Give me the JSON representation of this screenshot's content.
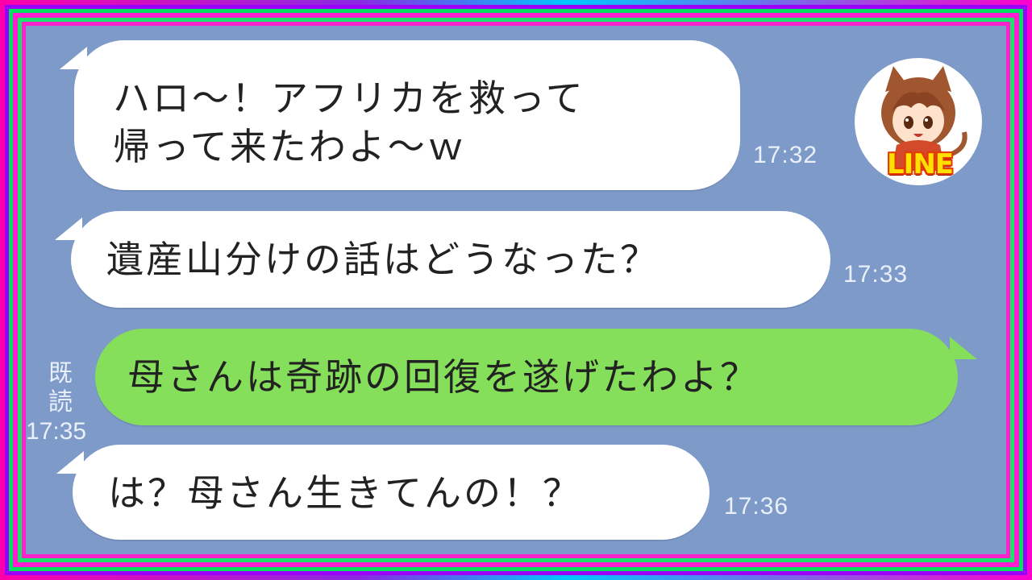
{
  "messages": [
    {
      "side": "left",
      "lines": [
        "ハロ〜！アフリカを救って",
        "帰って来たわよ〜ｗ"
      ],
      "time": "17:32"
    },
    {
      "side": "left",
      "lines": [
        "遺産山分けの話はどうなった？"
      ],
      "time": "17:33"
    },
    {
      "side": "right",
      "lines": [
        "母さんは奇跡の回復を遂げたわよ？"
      ],
      "read": "既読",
      "time": "17:35"
    },
    {
      "side": "left",
      "lines": [
        "は？母さん生きてんの！？"
      ],
      "time": "17:36"
    }
  ],
  "avatar": {
    "badge": "LINE",
    "icon": "character-avatar-icon"
  },
  "colors": {
    "chat_background": "#7d9ac9",
    "incoming_bubble": "#ffffff",
    "outgoing_bubble": "#86df5a",
    "frame_pink": "#ff22cc",
    "frame_green": "#1be36a"
  }
}
